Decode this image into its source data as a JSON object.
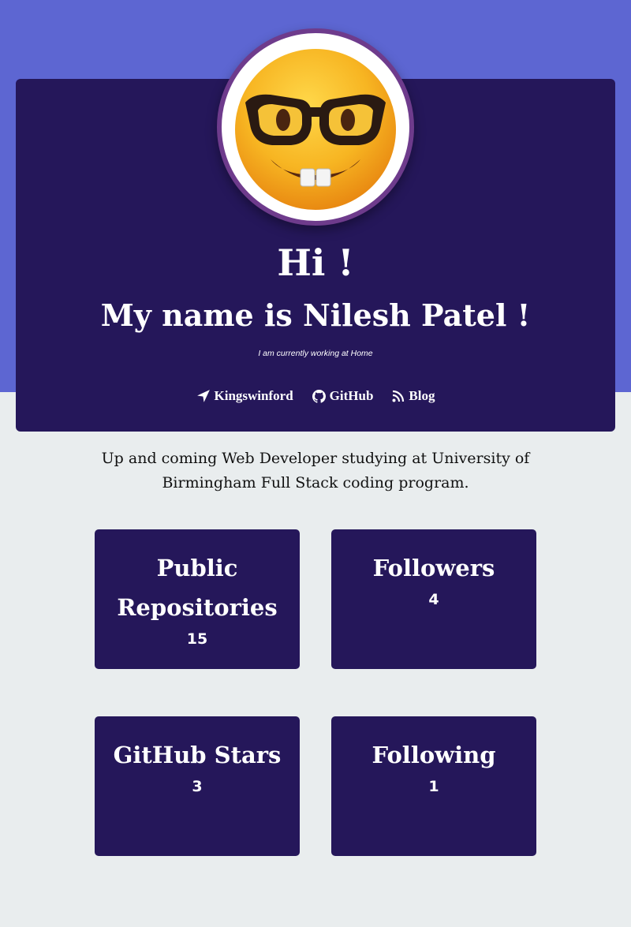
{
  "hero": {
    "greeting": "Hi !",
    "name_line": "My name is Nilesh Patel !",
    "working": "I am currently working at Home",
    "avatar_icon": "nerd-face-emoji"
  },
  "links": [
    {
      "label": "Kingswinford",
      "icon": "location-arrow-icon"
    },
    {
      "label": "GitHub",
      "icon": "github-icon"
    },
    {
      "label": "Blog",
      "icon": "rss-icon"
    }
  ],
  "bio": "Up and coming Web Developer studying at University of Birmingham Full Stack coding program.",
  "stats": [
    {
      "title": "Public Repositories",
      "value": "15"
    },
    {
      "title": "Followers",
      "value": "4"
    },
    {
      "title": "GitHub Stars",
      "value": "3"
    },
    {
      "title": "Following",
      "value": "1"
    }
  ],
  "colors": {
    "top_band": "#5d66d2",
    "card": "#25175a",
    "page_bg": "#e9edee",
    "avatar_border": "#6e3b8c"
  }
}
